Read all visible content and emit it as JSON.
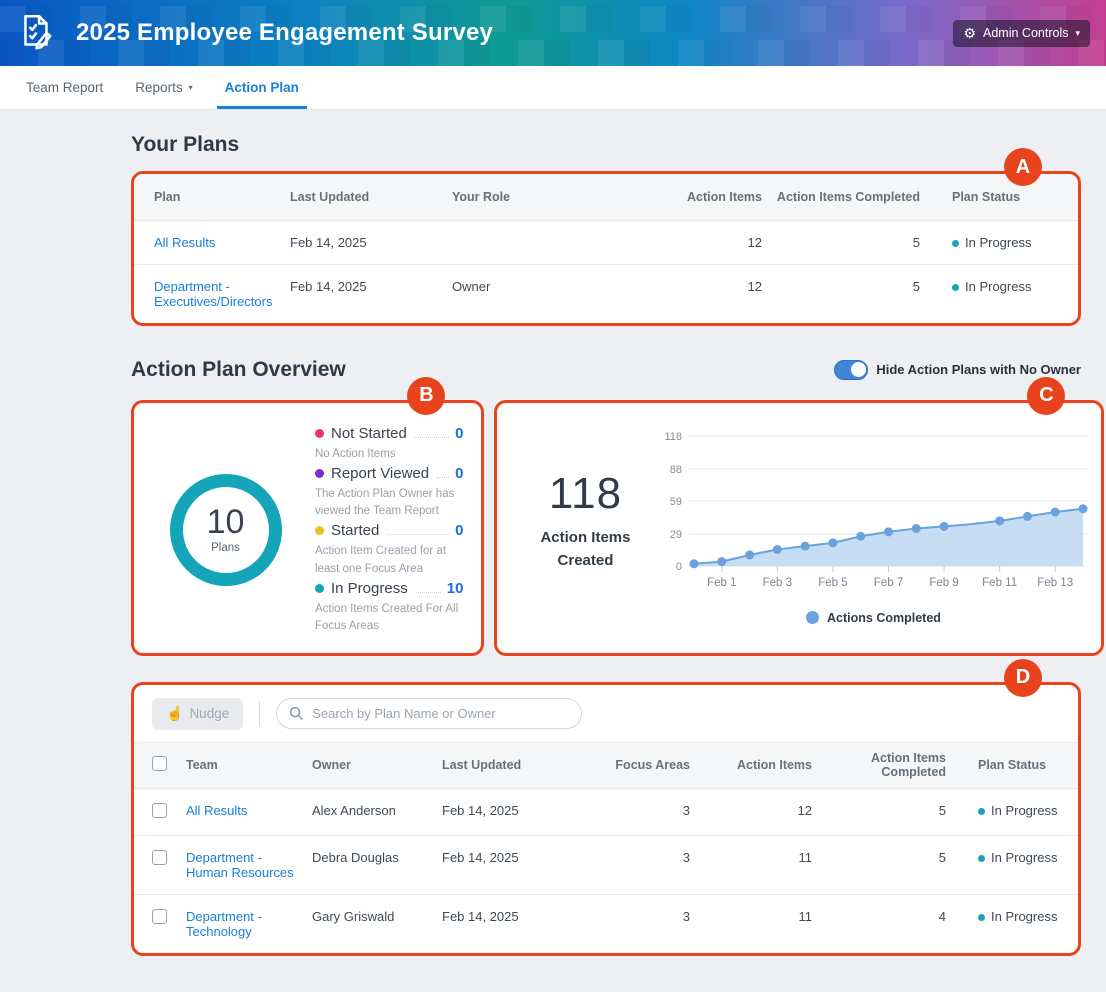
{
  "header": {
    "title": "2025 Employee Engagement Survey",
    "admin_label": "Admin Controls"
  },
  "nav": {
    "tabs": [
      {
        "label": "Team Report",
        "active": false,
        "caret": false
      },
      {
        "label": "Reports",
        "active": false,
        "caret": true
      },
      {
        "label": "Action Plan",
        "active": true,
        "caret": false
      }
    ]
  },
  "annotations": {
    "a": "A",
    "b": "B",
    "c": "C",
    "d": "D",
    "color": "#e8431c"
  },
  "your_plans": {
    "heading": "Your Plans",
    "columns": [
      "Plan",
      "Last Updated",
      "Your Role",
      "Action Items",
      "Action Items Completed",
      "Plan Status"
    ],
    "rows": [
      {
        "plan": "All Results",
        "last_updated": "Feb 14, 2025",
        "role": "",
        "action_items": "12",
        "completed": "5",
        "status": "In Progress"
      },
      {
        "plan": "Department - Executives/Directors",
        "last_updated": "Feb 14, 2025",
        "role": "Owner",
        "action_items": "12",
        "completed": "5",
        "status": "In Progress"
      }
    ]
  },
  "overview": {
    "heading": "Action Plan Overview",
    "toggle_label": "Hide Action Plans with No Owner",
    "toggle_on": true
  },
  "status_card": {
    "total": "10",
    "total_label": "Plans",
    "items": [
      {
        "label": "Not Started",
        "value": "0",
        "desc": "No Action Items",
        "color": "#ee2e7b"
      },
      {
        "label": "Report Viewed",
        "value": "0",
        "desc": "The Action Plan Owner has viewed the Team Report",
        "color": "#7a30cf"
      },
      {
        "label": "Started",
        "value": "0",
        "desc": "Action Item Created for at least one Focus Area",
        "color": "#eec11e"
      },
      {
        "label": "In Progress",
        "value": "10",
        "desc": "Action Items Created For All Focus Areas",
        "color": "#16a5b8"
      }
    ]
  },
  "chart_card": {
    "stat_value": "118",
    "stat_label_line1": "Action Items",
    "stat_label_line2": "Created",
    "legend_label": "Actions Completed"
  },
  "chart_data": {
    "type": "area",
    "title": "Actions Completed over time (total Action Items Created: 118)",
    "x": [
      "Jan 31",
      "Feb 1",
      "Feb 2",
      "Feb 3",
      "Feb 4",
      "Feb 5",
      "Feb 6",
      "Feb 7",
      "Feb 8",
      "Feb 9",
      "Feb 10",
      "Feb 11",
      "Feb 12",
      "Feb 13",
      "Feb 14"
    ],
    "series": [
      {
        "name": "Actions Completed",
        "values": [
          2,
          4,
          10,
          15,
          18,
          21,
          27,
          31,
          34,
          36,
          38,
          41,
          45,
          49,
          52
        ],
        "line_color": "#69a2dc",
        "fill_color": "#bdd7f2"
      }
    ],
    "hide_dot_indices": [
      10
    ],
    "y_ticks": [
      0,
      29,
      59,
      88,
      118
    ],
    "ylim": [
      0,
      118
    ],
    "x_tick_labels": [
      "Feb 1",
      "Feb 3",
      "Feb 5",
      "Feb 7",
      "Feb 9",
      "Feb 11",
      "Feb 13"
    ],
    "grid": "horizontal",
    "legend_position": "bottom"
  },
  "plans_table": {
    "nudge_label": "Nudge",
    "search_placeholder": "Search by Plan Name or Owner",
    "columns": [
      "Team",
      "Owner",
      "Last Updated",
      "Focus Areas",
      "Action Items",
      "Action Items Completed",
      "Plan Status"
    ],
    "rows": [
      {
        "team": "All Results",
        "owner": "Alex Anderson",
        "last_updated": "Feb 14, 2025",
        "focus_areas": "3",
        "action_items": "12",
        "completed": "5",
        "status": "In Progress"
      },
      {
        "team": "Department - Human Resources",
        "owner": "Debra Douglas",
        "last_updated": "Feb 14, 2025",
        "focus_areas": "3",
        "action_items": "11",
        "completed": "5",
        "status": "In Progress"
      },
      {
        "team": "Department - Technology",
        "owner": "Gary Griswald",
        "last_updated": "Feb 14, 2025",
        "focus_areas": "3",
        "action_items": "11",
        "completed": "4",
        "status": "In Progress"
      }
    ]
  },
  "colors": {
    "link": "#1a7fd8",
    "status_dot": "#16a5b8",
    "annotation": "#e8431c",
    "header_gradient": [
      "#0a57c4",
      "#0f9b92",
      "#0d86c6",
      "#7e68c8",
      "#c53e90"
    ]
  }
}
